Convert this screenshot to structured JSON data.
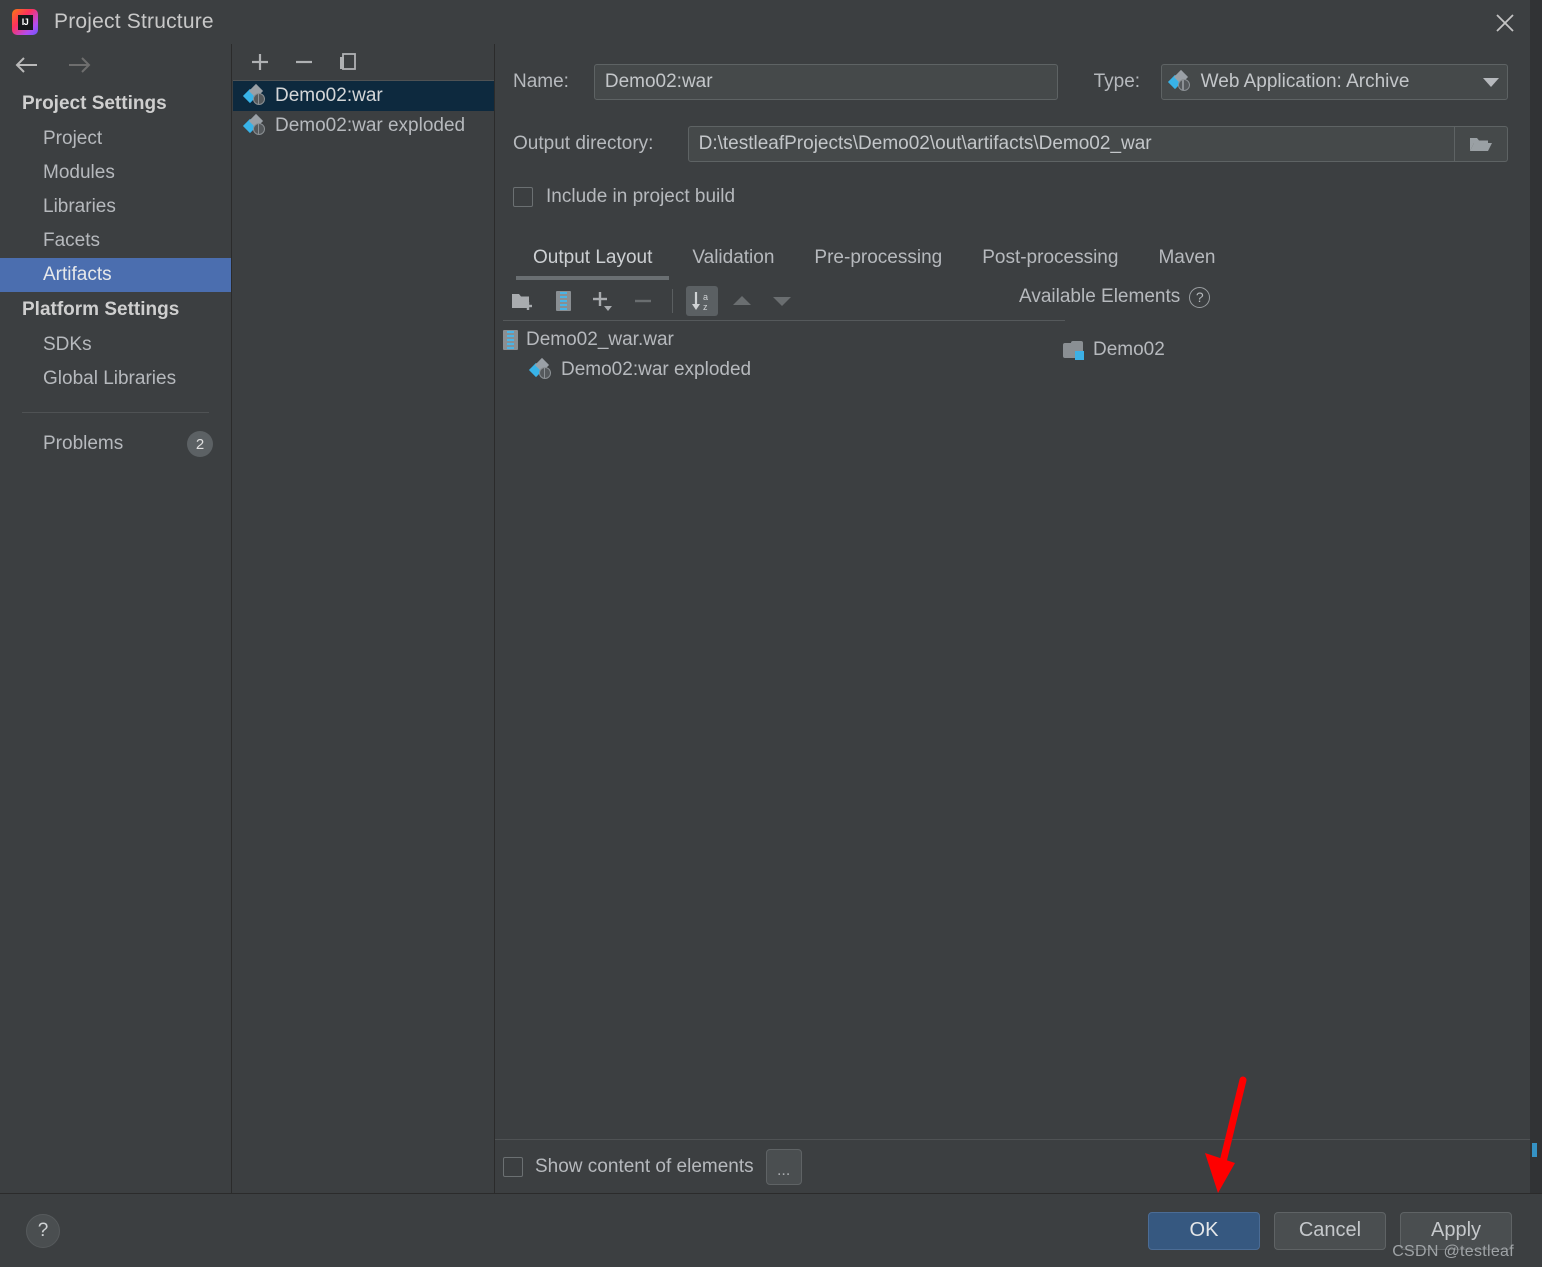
{
  "window": {
    "title": "Project Structure",
    "app_icon": "intellij-idea-logo",
    "close_icon": "close-icon"
  },
  "sidebar": {
    "back_icon": "arrow-left-icon",
    "forward_icon": "arrow-right-icon",
    "groups": [
      {
        "title": "Project Settings",
        "items": [
          {
            "label": "Project",
            "selected": false
          },
          {
            "label": "Modules",
            "selected": false
          },
          {
            "label": "Libraries",
            "selected": false
          },
          {
            "label": "Facets",
            "selected": false
          },
          {
            "label": "Artifacts",
            "selected": true
          }
        ]
      },
      {
        "title": "Platform Settings",
        "items": [
          {
            "label": "SDKs",
            "selected": false
          },
          {
            "label": "Global Libraries",
            "selected": false
          }
        ]
      }
    ],
    "problems": {
      "label": "Problems",
      "count": "2"
    }
  },
  "artifact_panel": {
    "toolbar": [
      {
        "name": "add-artifact-button",
        "icon": "plus-icon"
      },
      {
        "name": "remove-artifact-button",
        "icon": "minus-icon"
      },
      {
        "name": "copy-artifact-button",
        "icon": "copy-icon"
      }
    ],
    "items": [
      {
        "label": "Demo02:war",
        "icon": "war-artifact-icon",
        "selected": true
      },
      {
        "label": "Demo02:war exploded",
        "icon": "war-artifact-icon",
        "selected": false
      }
    ]
  },
  "detail": {
    "name_label": "Name:",
    "name_value": "Demo02:war",
    "type_label": "Type:",
    "type_value": "Web Application: Archive",
    "type_icon": "war-artifact-icon",
    "output_dir_label": "Output directory:",
    "output_dir_value": "D:\\testleafProjects\\Demo02\\out\\artifacts\\Demo02_war",
    "browse_icon": "folder-open-icon",
    "include_in_build_label": "Include in project build",
    "include_in_build_checked": false,
    "tabs": [
      {
        "label": "Output Layout",
        "active": true
      },
      {
        "label": "Validation",
        "active": false
      },
      {
        "label": "Pre-processing",
        "active": false
      },
      {
        "label": "Post-processing",
        "active": false
      },
      {
        "label": "Maven",
        "active": false
      }
    ],
    "layout_toolbar": [
      {
        "name": "create-directory-button",
        "icon": "folder-add-icon",
        "state": "normal"
      },
      {
        "name": "create-archive-button",
        "icon": "archive-icon",
        "state": "normal"
      },
      {
        "name": "add-copy-of-button",
        "icon": "plus-dropdown-icon",
        "state": "normal"
      },
      {
        "name": "remove-element-button",
        "icon": "minus-icon",
        "state": "disabled"
      },
      {
        "name": "sort-elements-button",
        "icon": "sort-az-icon",
        "state": "pressed"
      },
      {
        "name": "move-up-button",
        "icon": "arrow-up-icon",
        "state": "disabled"
      },
      {
        "name": "move-down-button",
        "icon": "arrow-down-icon",
        "state": "disabled"
      }
    ],
    "available_elements_label": "Available Elements",
    "available_elements_help_icon": "help-circle-icon",
    "output_tree": [
      {
        "label": "Demo02_war.war",
        "icon": "archive-icon",
        "indent": 0
      },
      {
        "label": "Demo02:war exploded",
        "icon": "war-artifact-icon",
        "indent": 1
      }
    ],
    "available_tree": [
      {
        "label": "Demo02",
        "icon": "module-icon"
      }
    ],
    "show_content_label": "Show content of elements",
    "show_content_checked": false,
    "dots_button_label": "..."
  },
  "footer": {
    "help_label": "?",
    "buttons": [
      {
        "label": "OK",
        "style": "primary"
      },
      {
        "label": "Cancel",
        "style": "normal"
      },
      {
        "label": "Apply",
        "style": "normal"
      }
    ],
    "watermark": "CSDN @testleaf"
  },
  "annotation": {
    "arrow_color": "#fe0000",
    "arrow_name": "red-pointer-arrow"
  },
  "colors": {
    "window_bg": "#3c3f41",
    "selection_blue": "#4b6eaf",
    "list_selection": "#0d293e",
    "accent_blue": "#3cb0e5",
    "primary_button": "#365880"
  }
}
